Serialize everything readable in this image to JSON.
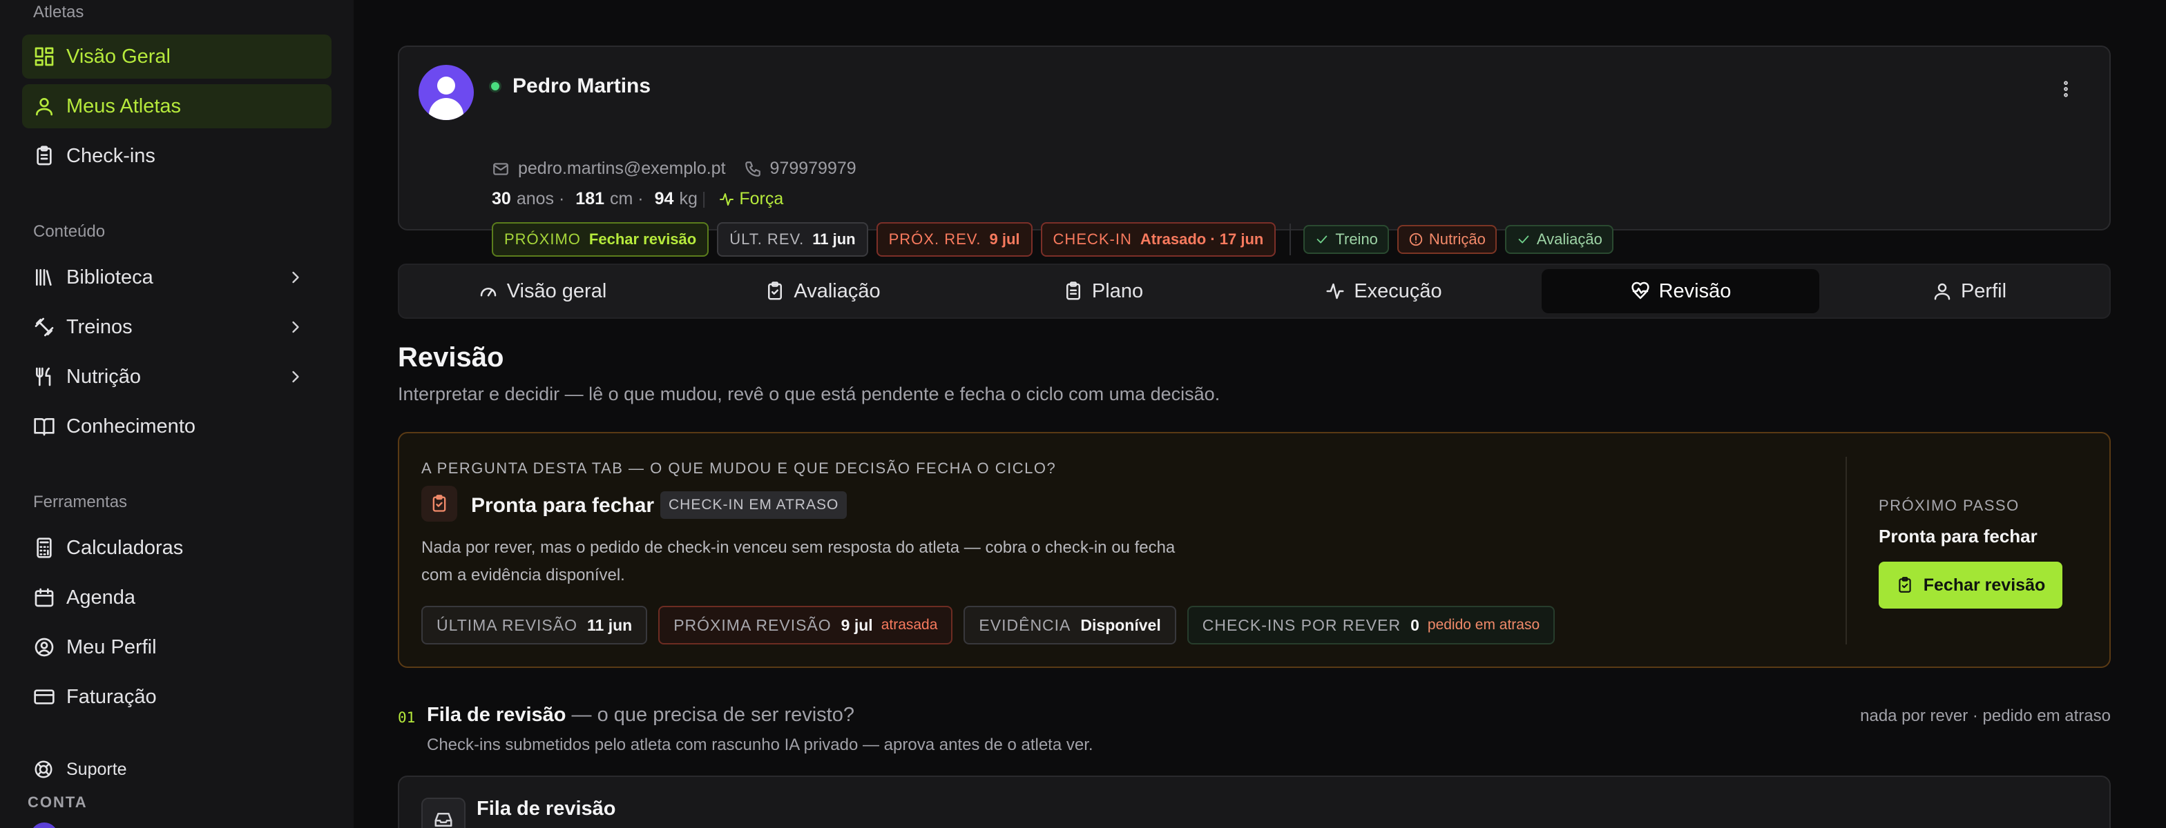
{
  "sidebar": {
    "sections": {
      "athletes": "Atletas",
      "content": "Conteúdo",
      "tools": "Ferramentas"
    },
    "items": [
      {
        "label": "Visão Geral",
        "icon": "dashboard-icon",
        "active": true
      },
      {
        "label": "Meus Atletas",
        "icon": "user-icon",
        "active": true
      },
      {
        "label": "Check-ins",
        "icon": "clipboard-icon"
      },
      {
        "label": "Biblioteca",
        "icon": "library-icon",
        "chevron": true
      },
      {
        "label": "Treinos",
        "icon": "dumbbell-icon",
        "chevron": true
      },
      {
        "label": "Nutrição",
        "icon": "utensils-icon",
        "chevron": true
      },
      {
        "label": "Conhecimento",
        "icon": "book-icon"
      },
      {
        "label": "Calculadoras",
        "icon": "calculator-icon"
      },
      {
        "label": "Agenda",
        "icon": "calendar-icon"
      },
      {
        "label": "Meu Perfil",
        "icon": "user-circle-icon"
      },
      {
        "label": "Faturação",
        "icon": "credit-card-icon"
      }
    ],
    "support": "Suporte",
    "account_label": "CONTA"
  },
  "athlete": {
    "name": "Pedro Martins",
    "email": "pedro.martins@exemplo.pt",
    "phone": "979979979",
    "age": "30",
    "age_unit": "anos ·",
    "height": "181",
    "height_unit": "cm ·",
    "weight": "94",
    "weight_unit": "kg",
    "goal": "Força",
    "chips": [
      {
        "key": "PRÓXIMO",
        "value": "Fechar revisão",
        "tone": "green"
      },
      {
        "key": "ÚLT. REV.",
        "value": "11 jun",
        "tone": "neutral"
      },
      {
        "key": "PRÓX. REV.",
        "value": "9 jul",
        "tone": "red"
      },
      {
        "key": "CHECK-IN",
        "value": "Atrasado · 17 jun",
        "tone": "red"
      }
    ],
    "tags": [
      {
        "label": "Treino",
        "status": "ok"
      },
      {
        "label": "Nutrição",
        "status": "warn"
      },
      {
        "label": "Avaliação",
        "status": "ok"
      }
    ]
  },
  "tabs": [
    {
      "label": "Visão geral",
      "icon": "gauge-icon"
    },
    {
      "label": "Avaliação",
      "icon": "clipboard-check-icon"
    },
    {
      "label": "Plano",
      "icon": "clipboard-list-icon"
    },
    {
      "label": "Execução",
      "icon": "activity-icon"
    },
    {
      "label": "Revisão",
      "icon": "heart-pulse-icon",
      "active": true
    },
    {
      "label": "Perfil",
      "icon": "user-icon"
    }
  ],
  "review": {
    "title": "Revisão",
    "subtitle": "Interpretar e decidir — lê o que mudou, revê o que está pendente e fecha o ciclo com uma decisão.",
    "question": "A PERGUNTA DESTA TAB — O QUE MUDOU E QUE DECISÃO FECHA O CICLO?",
    "status_title": "Pronta para fechar",
    "status_badge": "CHECK-IN EM ATRASO",
    "status_desc": "Nada por rever, mas o pedido de check-in venceu sem resposta do atleta — cobra o check-in ou fecha com a evidência disponível.",
    "metrics": [
      {
        "key": "ÚLTIMA REVISÃO",
        "value": "11 jun",
        "note": ""
      },
      {
        "key": "PRÓXIMA REVISÃO",
        "value": "9 jul",
        "note": "atrasada"
      },
      {
        "key": "EVIDÊNCIA",
        "value": "Disponível",
        "note": ""
      },
      {
        "key": "CHECK-INS POR REVER",
        "value": "0",
        "note": "pedido em atraso"
      }
    ],
    "next_step_label": "PRÓXIMO PASSO",
    "next_step_title": "Pronta para fechar",
    "close_button": "Fechar revisão"
  },
  "queue": {
    "number": "01",
    "title": "Fila de revisão",
    "title_suffix": " — o que precisa de ser revisto?",
    "right_note": "nada por rever · pedido em atraso",
    "subtitle": "Check-ins submetidos pelo atleta com rascunho IA privado — aprova antes de o atleta ver.",
    "card_title": "Fila de revisão"
  },
  "colors": {
    "accent": "#b6ea3c",
    "button": "#a3e635",
    "danger": "#f87a5e",
    "online": "#4ade80"
  }
}
